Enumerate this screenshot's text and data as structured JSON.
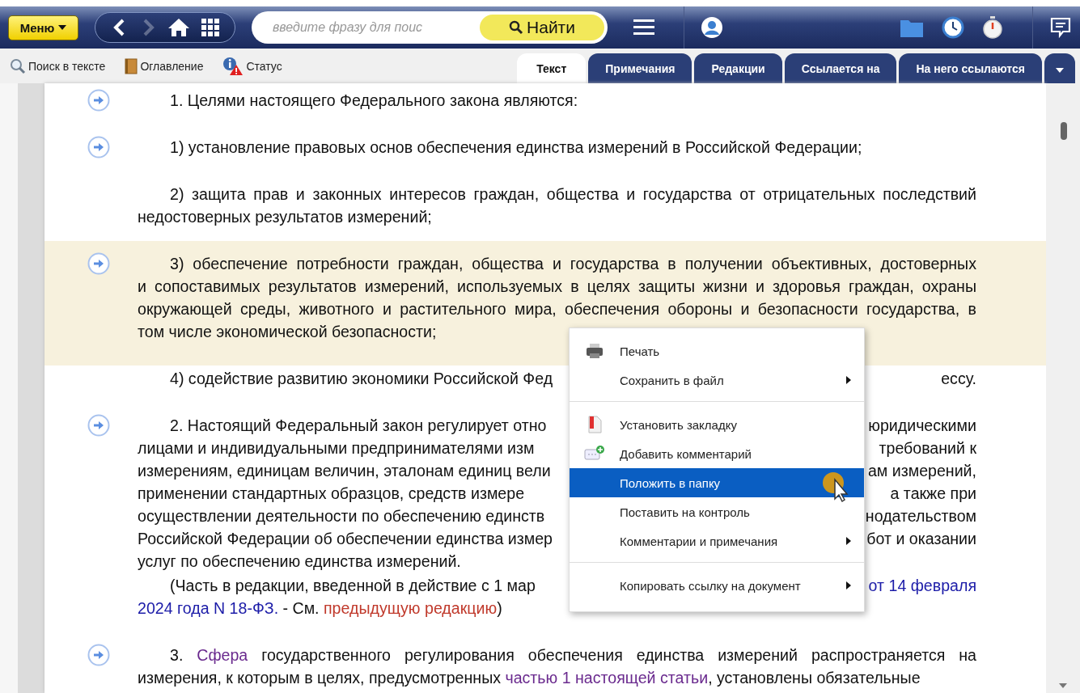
{
  "topbar": {
    "menu_button": "Меню",
    "back": {
      "disabled": false
    },
    "forward": {
      "disabled": true
    },
    "search": {
      "placeholder": "введите фразу для поис"
    },
    "search_button": "Найти"
  },
  "toolbar": {
    "tools": [
      "Поиск в тексте",
      "Оглавление",
      "Статус"
    ],
    "tabs": [
      {
        "label": "Текст",
        "selected": true
      },
      {
        "label": "Примечания",
        "selected": false
      },
      {
        "label": "Редакции",
        "selected": false
      },
      {
        "label": "Ссылается на",
        "selected": false
      },
      {
        "label": "На него ссылаются",
        "selected": false
      }
    ]
  },
  "document": {
    "paragraphs": [
      {
        "kind": "text",
        "marker": true,
        "highlighted": false,
        "lines": [
          {
            "left": [
              {
                "kind": "plain",
                "text": "1. Целями настоящего Федерального закона являются:"
              }
            ]
          }
        ]
      },
      {
        "kind": "text",
        "marker": true,
        "highlighted": false,
        "lines": [
          {
            "left": [
              {
                "kind": "plain",
                "text": "1) установление правовых основ обеспечения единства измерений в Российской Федерации;"
              }
            ]
          }
        ]
      },
      {
        "kind": "text",
        "marker": false,
        "highlighted": false,
        "lines": [
          {
            "left": [
              {
                "kind": "plain",
                "text": "2) защита прав и законных интересов граждан, общества и государства от отрицательных последствий"
              }
            ]
          },
          {
            "left": [
              {
                "kind": "plain",
                "text": "недостоверных результатов измерений;"
              }
            ]
          }
        ]
      },
      {
        "kind": "text",
        "marker": true,
        "highlighted": true,
        "lines": [
          {
            "left": [
              {
                "kind": "plain",
                "text": "3) обеспечение потребности граждан, общества и государства в получении объективных, достоверных"
              }
            ]
          },
          {
            "left": [
              {
                "kind": "plain",
                "text": "и сопоставимых результатов измерений, используемых в целях защиты жизни и здоровья граждан, охраны"
              }
            ]
          },
          {
            "left": [
              {
                "kind": "plain",
                "text": "окружающей среды, животного и растительного мира, обеспечения обороны и безопасности государства, в"
              }
            ]
          },
          {
            "left": [
              {
                "kind": "plain",
                "text": "том числе экономической безопасности;"
              }
            ]
          }
        ]
      },
      {
        "kind": "text",
        "marker": false,
        "highlighted": false,
        "lines": [
          {
            "left": [
              {
                "kind": "plain",
                "text": "4) содействие развитию экономики Российской Фед"
              }
            ],
            "right": [
              {
                "kind": "plain",
                "text": "ессу."
              }
            ]
          }
        ]
      },
      {
        "kind": "text",
        "marker": true,
        "highlighted": false,
        "lines": [
          {
            "left": [
              {
                "kind": "plain",
                "text": "2. Настоящий Федеральный закон регулирует отно"
              }
            ],
            "right": [
              {
                "kind": "plain",
                "text": "юридическими"
              }
            ]
          },
          {
            "left": [
              {
                "kind": "plain",
                "text": "лицами и индивидуальными предпринимателями изм"
              }
            ],
            "right": [
              {
                "kind": "plain",
                "text": "требований к"
              }
            ]
          },
          {
            "left": [
              {
                "kind": "plain",
                "text": "измерениям, единицам величин, эталонам единиц вели"
              }
            ],
            "right": [
              {
                "kind": "plain",
                "text": "ам измерений,"
              }
            ]
          },
          {
            "left": [
              {
                "kind": "plain",
                "text": "применении стандартных образцов, средств измере"
              }
            ],
            "right": [
              {
                "kind": "plain",
                "text": "а также при"
              }
            ]
          },
          {
            "left": [
              {
                "kind": "plain",
                "text": "осуществлении деятельности по обеспечению единств"
              }
            ],
            "right": [
              {
                "kind": "plain",
                "text": "нодательством"
              }
            ]
          },
          {
            "left": [
              {
                "kind": "plain",
                "text": "Российской Федерации об обеспечении единства измер"
              }
            ],
            "right": [
              {
                "kind": "plain",
                "text": "бот и оказании"
              }
            ]
          },
          {
            "left": [
              {
                "kind": "plain",
                "text": "услуг по обеспечению единства измерений."
              }
            ]
          }
        ]
      },
      {
        "kind": "note",
        "marker": false,
        "highlighted": false,
        "lines": [
          {
            "left": [
              {
                "kind": "plain",
                "text": "(Часть в редакции, введенной в действие с 1 мар"
              }
            ],
            "right": [
              {
                "kind": "link",
                "text": "от 14 февраля"
              }
            ]
          },
          {
            "left": [
              {
                "kind": "link",
                "text": "2024 года N 18-ФЗ."
              },
              {
                "kind": "plain",
                "text": " - См. "
              },
              {
                "kind": "old",
                "text": "предыдущую редакцию"
              },
              {
                "kind": "plain",
                "text": ")"
              }
            ]
          }
        ]
      },
      {
        "kind": "text",
        "marker": true,
        "highlighted": false,
        "lines": [
          {
            "left": [
              {
                "kind": "plain",
                "text": "3. "
              },
              {
                "kind": "visited",
                "text": "Сфера"
              },
              {
                "kind": "plain",
                "text": " государственного регулирования обеспечения единства измерений распространяется на"
              }
            ]
          },
          {
            "left": [
              {
                "kind": "plain",
                "text": "измерения, к которым в целях, предусмотренных "
              },
              {
                "kind": "visited",
                "text": "частью 1 настоящей статьи"
              },
              {
                "kind": "plain",
                "text": ", установлены обязательные"
              }
            ]
          }
        ]
      }
    ]
  },
  "context_menu": {
    "items": [
      {
        "kind": "item",
        "label": "Печать",
        "submenu": false,
        "selected": false
      },
      {
        "kind": "item",
        "label": "Сохранить в файл",
        "submenu": true,
        "selected": false
      },
      {
        "kind": "separator"
      },
      {
        "kind": "item",
        "label": "Установить закладку",
        "submenu": false,
        "selected": false
      },
      {
        "kind": "item",
        "label": "Добавить комментарий",
        "submenu": false,
        "selected": false
      },
      {
        "kind": "item",
        "label": "Положить в папку",
        "submenu": false,
        "selected": true
      },
      {
        "kind": "item",
        "label": "Поставить на контроль",
        "submenu": false,
        "selected": false
      },
      {
        "kind": "item",
        "label": "Комментарии и примечания",
        "submenu": true,
        "selected": false
      },
      {
        "kind": "separator"
      },
      {
        "kind": "item",
        "label": "Копировать ссылку на документ",
        "submenu": true,
        "selected": false
      }
    ]
  }
}
